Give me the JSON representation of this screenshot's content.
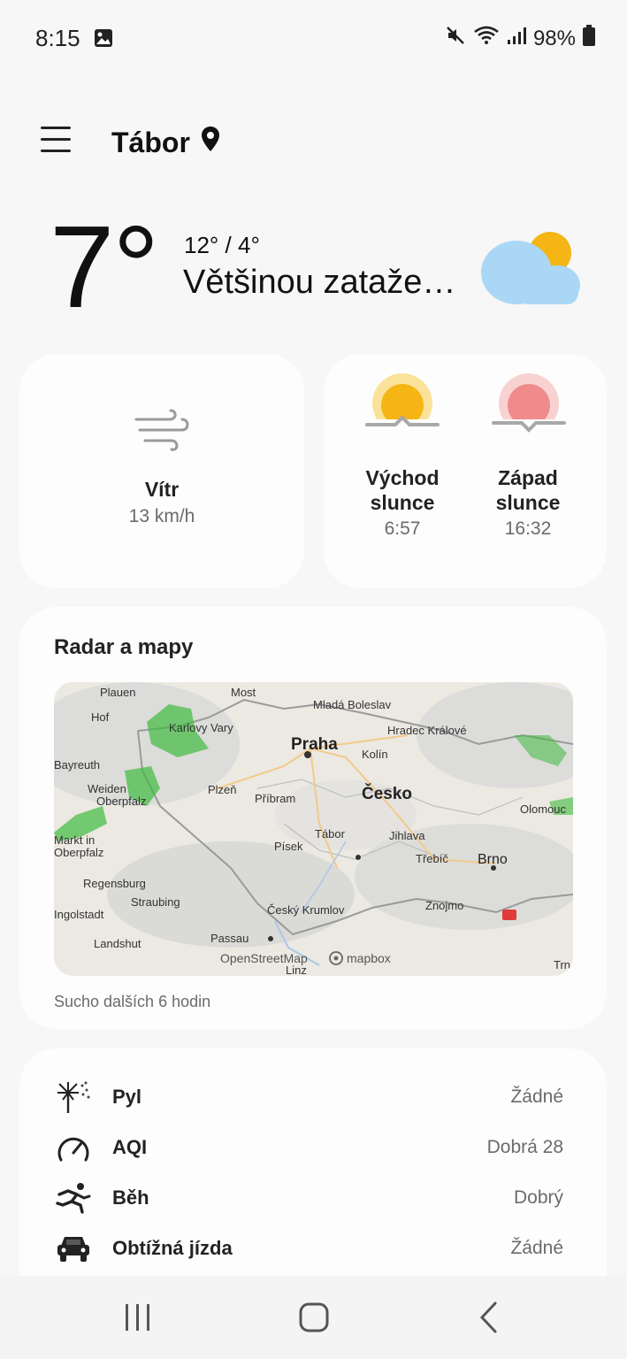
{
  "status": {
    "time": "8:15",
    "battery": "98%"
  },
  "header": {
    "city": "Tábor"
  },
  "current": {
    "temperature": "7°",
    "range": "12° / 4°",
    "condition": "Většinou zataže…"
  },
  "wind": {
    "label": "Vítr",
    "value": "13 km/h"
  },
  "sun": {
    "sunrise_label_1": "Východ",
    "sunrise_label_2": "slunce",
    "sunrise_time": "6:57",
    "sunset_label_1": "Západ",
    "sunset_label_2": "slunce",
    "sunset_time": "16:32"
  },
  "radar": {
    "title": "Radar a mapy",
    "footer": "Sucho dalších 6 hodin",
    "attribution_osm": "OpenStreetMap",
    "attribution_mapbox": "mapbox",
    "places": [
      "Plauen",
      "Most",
      "Mladá Boleslav",
      "Hof",
      "Karlovy Vary",
      "Hradec Králové",
      "Bayreuth",
      "Praha",
      "Kolín",
      "Weiden",
      "Oberpfalz",
      "Plzeň",
      "Příbram",
      "Česko",
      "Olomouc",
      "Markt in Oberpfalz",
      "Tábor",
      "Jihlava",
      "Písek",
      "Třebíč",
      "Brno",
      "Regensburg",
      "Straubing",
      "Ingolstadt",
      "Český Krumlov",
      "Znojmo",
      "Landshut",
      "Passau",
      "Linz",
      "Trn"
    ]
  },
  "details": [
    {
      "label": "Pyl",
      "value": "Žádné",
      "icon": "pollen-icon"
    },
    {
      "label": "AQI",
      "value": "Dobrá 28",
      "icon": "gauge-icon"
    },
    {
      "label": "Běh",
      "value": "Dobrý",
      "icon": "running-icon"
    },
    {
      "label": "Obtížná jízda",
      "value": "Žádné",
      "icon": "car-icon"
    }
  ],
  "colors": {
    "sunrise": "#f5b514",
    "sunset": "#ef8b8b",
    "cloud": "#a9d7f5",
    "radar_rain": "#3fba3f"
  }
}
